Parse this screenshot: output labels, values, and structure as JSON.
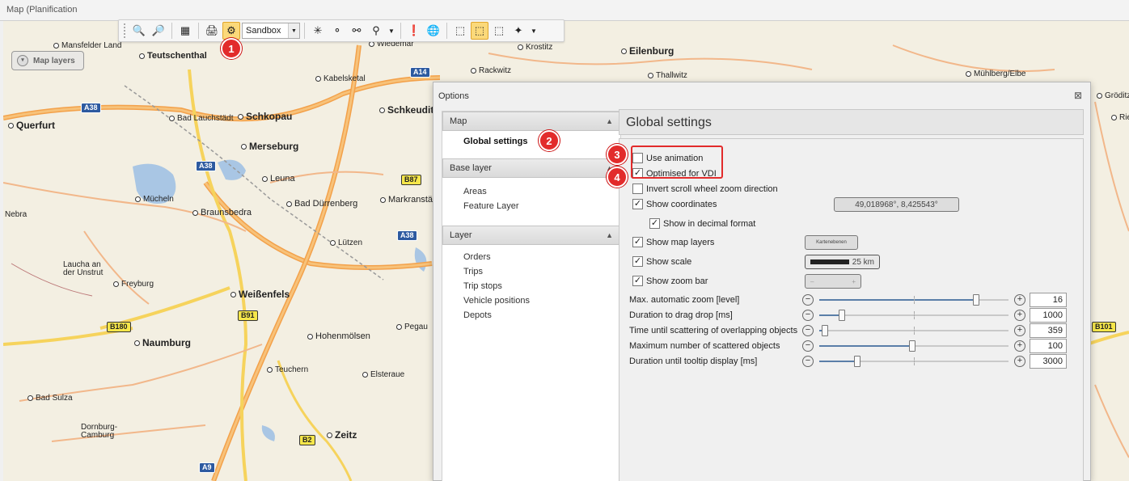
{
  "window": {
    "title": "Map (Planification"
  },
  "map": {
    "layers_button": "Map layers",
    "places_big": [
      "Teutschenthal",
      "Schkopau",
      "Merseburg",
      "Leuna",
      "Bad Dürrenberg",
      "Braunsbedra",
      "Markranstädt",
      "Weißenfels",
      "Naumburg",
      "Hohenmölsen",
      "Zeitz",
      "Eilenburg"
    ],
    "places": [
      "Mansfelder Land",
      "Wiedemar",
      "Krostitz",
      "Rackwitz",
      "Thallwitz",
      "Mühlberg/Elbe",
      "Kabelsketal",
      "Schkeuditz",
      "Querfurt",
      "Bad Lauchstädt",
      "Mücheln",
      "Nebra",
      "Lützen",
      "Laucha an der Unstrut",
      "Freyburg",
      "Pegau",
      "Teuchern",
      "Elsteraue",
      "Bad Sulza",
      "Dornburg-Camburg",
      "Gröditz",
      "Riesa"
    ],
    "shields": [
      "A38",
      "A38",
      "A38",
      "A14",
      "B87",
      "B91",
      "B180",
      "B2",
      "A9",
      "B101"
    ]
  },
  "toolbar": {
    "zoom_in_icon": "zoom-in-icon",
    "select_value": "Sandbox"
  },
  "markers": [
    "1",
    "2",
    "3",
    "4"
  ],
  "dialog": {
    "title": "Options",
    "close": "⊠",
    "nav": {
      "sections": [
        {
          "label": "Map",
          "items": [
            "Global settings"
          ]
        },
        {
          "label": "Base layer",
          "items": [
            "Areas",
            "Feature Layer"
          ]
        },
        {
          "label": "Layer",
          "items": [
            "Orders",
            "Trips",
            "Trip stops",
            "Vehicle positions",
            "Depots"
          ]
        }
      ]
    },
    "content": {
      "title": "Global settings",
      "checkboxes": [
        {
          "label": "Use animation",
          "checked": false
        },
        {
          "label": "Optimised for VDI",
          "checked": true
        },
        {
          "label": "Invert scroll wheel zoom direction",
          "checked": false
        },
        {
          "label": "Show coordinates",
          "checked": true
        },
        {
          "label": "Show in decimal format",
          "checked": true
        },
        {
          "label": "Show map layers",
          "checked": true
        },
        {
          "label": "Show scale",
          "checked": true
        },
        {
          "label": "Show zoom bar",
          "checked": true
        }
      ],
      "coordinates_value": "49,018968°, 8,425543°",
      "map_layers_preview": "Kartenebenen",
      "scale_value": "25 km",
      "sliders": [
        {
          "label": "Max. automatic zoom [level]",
          "value": "16",
          "fraction": 0.83
        },
        {
          "label": "Duration to drag  drop [ms]",
          "value": "1000",
          "fraction": 0.12
        },
        {
          "label": "Time until scattering of overlapping objects",
          "value": "359",
          "fraction": 0.03
        },
        {
          "label": "Maximum number of scattered objects",
          "value": "100",
          "fraction": 0.49
        },
        {
          "label": "Duration until tooltip display [ms]",
          "value": "3000",
          "fraction": 0.2
        }
      ]
    }
  }
}
